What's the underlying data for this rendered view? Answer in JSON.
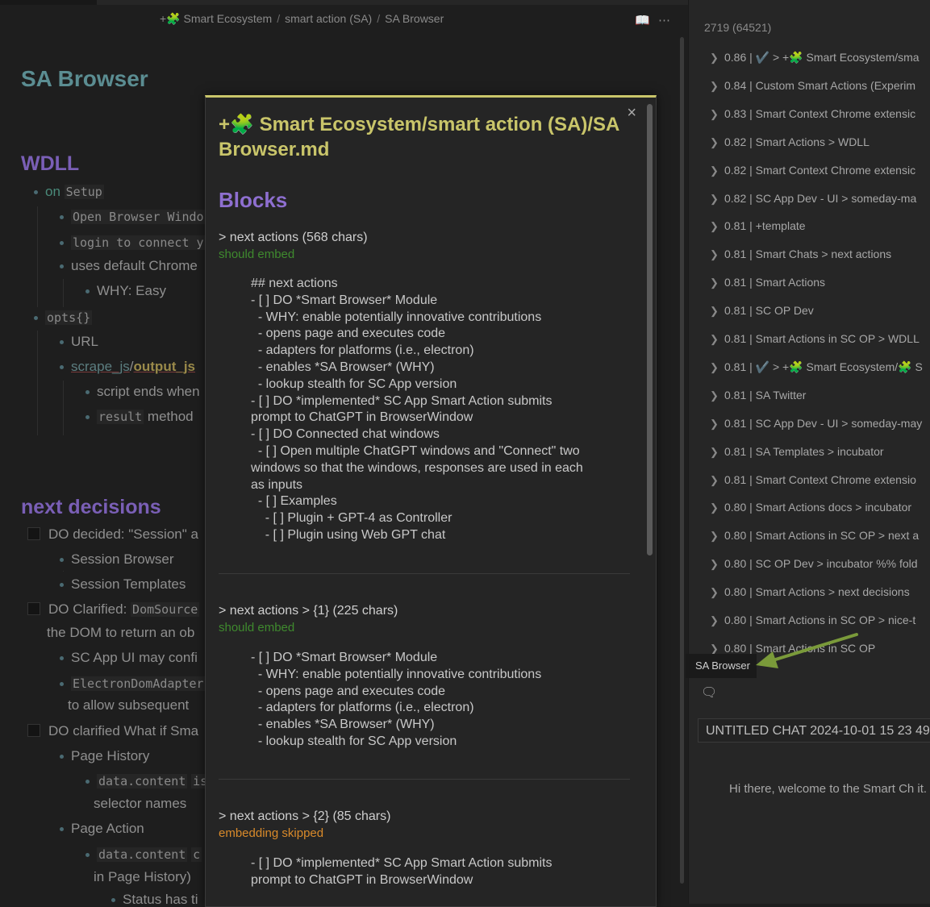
{
  "breadcrumb": {
    "item1": "+🧩 Smart Ecosystem",
    "item2": "smart action (SA)",
    "item3": "SA Browser"
  },
  "note": {
    "title": "SA Browser",
    "h_wdll": "WDLL",
    "on": "on",
    "setup": "Setup",
    "open_browser": "Open Browser Windo",
    "login": "login to connect y",
    "uses_default": "uses default Chrome",
    "why_easy": "WHY: Easy",
    "opts": "opts{}",
    "url": "URL",
    "scrape": "scrape_js",
    "slash": "/",
    "output": "output_js",
    "script_ends": "script ends when",
    "result": "result",
    "method": "method",
    "h_next": "next decisions",
    "dec1": "DO decided: \"Session\" a",
    "session_browser": "Session Browser",
    "session_templates": "Session Templates",
    "dec2_a": "DO Clarified:",
    "dec2_code": "DomSource",
    "dec2_b": "the DOM to return an ob",
    "sc_app_ui": "SC App UI may confi",
    "electron": "ElectronDomAdapter",
    "allow_sub": "to allow subsequent",
    "dec3": "DO clarified What if Sma",
    "page_history": "Page History",
    "data_content1": "data.content",
    "is": "is",
    "selector_names": "selector names",
    "page_action": "Page Action",
    "data_content2": "data.content",
    "c": "c",
    "in_page_history": "in Page History)",
    "status": "Status has ti"
  },
  "popover": {
    "close": "×",
    "title": "+🧩 Smart Ecosystem/smart action (SA)/SA Browser.md",
    "blocks_heading": "Blocks",
    "blocks": [
      {
        "head": "> next actions (568 chars)",
        "status": "should embed",
        "text": "## next actions\n- [ ] DO *Smart Browser* Module\n  - WHY: enable potentially innovative contributions\n  - opens page and executes code\n  - adapters for platforms (i.e., electron)\n  - enables *SA Browser* (WHY)\n  - lookup stealth for SC App version\n- [ ] DO *implemented* SC App Smart Action submits\nprompt to ChatGPT in BrowserWindow\n- [ ] DO Connected chat windows\n  - [ ] Open multiple ChatGPT windows and \"Connect\" two\nwindows so that the windows, responses are used in each\nas inputs\n  - [ ] Examples\n    - [ ] Plugin + GPT-4 as Controller\n    - [ ] Plugin using Web GPT chat"
      },
      {
        "head": "> next actions > {1} (225 chars)",
        "status": "should embed",
        "text": "- [ ] DO *Smart Browser* Module\n  - WHY: enable potentially innovative contributions\n  - opens page and executes code\n  - adapters for platforms (i.e., electron)\n  - enables *SA Browser* (WHY)\n  - lookup stealth for SC App version"
      },
      {
        "head": "> next actions > {2} (85 chars)",
        "status": "embedding skipped",
        "text": "- [ ] DO *implemented* SC App Smart Action submits\nprompt to ChatGPT in BrowserWindow"
      }
    ]
  },
  "right_panel": {
    "count": "2719 (64521)",
    "results": [
      "0.86 | ✔️ > +🧩 Smart Ecosystem/sma",
      "0.84 | Custom Smart Actions (Experim",
      "0.83 | Smart Context Chrome extensic",
      "0.82 | Smart Actions > WDLL",
      "0.82 | Smart Context Chrome extensic",
      "0.82 | SC App Dev - UI > someday-ma",
      "0.81 | +template",
      "0.81 | Smart Chats > next actions",
      "0.81 | Smart Actions",
      "0.81 | SC OP Dev",
      "0.81 | Smart Actions in SC OP > WDLL",
      "0.81 | ✔️ > +🧩 Smart Ecosystem/🧩 S",
      "0.81 | SA Twitter",
      "0.81 | SC App Dev - UI > someday-may",
      "0.81 | SA Templates > incubator",
      "0.81 | Smart Context Chrome extensio",
      "0.80 | Smart Actions docs > incubator",
      "0.80 | Smart Actions in SC OP > next a",
      "0.80 | SC OP Dev > incubator %% fold",
      "0.80 | Smart Actions > next decisions",
      "0.80 | Smart Actions in SC OP > nice-t",
      "0.80 | Smart Actions in SC OP"
    ],
    "tab_label": "SA Browser",
    "chat_title": "UNTITLED CHAT 2024-10-01 15 23 49",
    "chat_message": "Hi there, welcome to the Smart Ch it."
  },
  "colors": {
    "popover_title": "#c9c56a",
    "blocks_heading": "#8e6fd0",
    "should_embed": "#3f8a2e",
    "embedding_skipped": "#d98a2a",
    "arrow": "#7a9a3a"
  },
  "icons": [
    "book-icon",
    "more-icon",
    "close-icon",
    "chevron-right-icon",
    "chat-icon"
  ]
}
